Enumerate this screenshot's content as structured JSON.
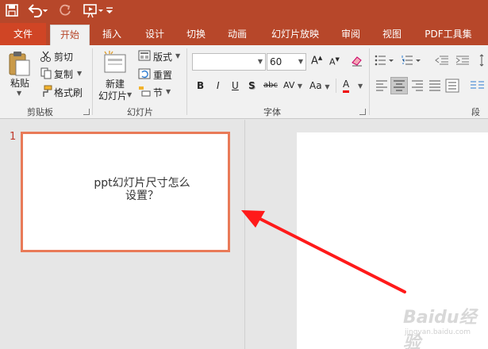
{
  "quick_access": {
    "icons": [
      "save-icon",
      "undo-icon",
      "redo-icon",
      "present-from-start-icon",
      "customize-qat-icon"
    ]
  },
  "tabs": [
    {
      "label": "文件"
    },
    {
      "label": "开始"
    },
    {
      "label": "插入"
    },
    {
      "label": "设计"
    },
    {
      "label": "切换"
    },
    {
      "label": "动画"
    },
    {
      "label": "幻灯片放映"
    },
    {
      "label": "审阅"
    },
    {
      "label": "视图"
    },
    {
      "label": "PDF工具集"
    }
  ],
  "ribbon": {
    "clipboard": {
      "paste": "粘贴",
      "cut": "剪切",
      "copy": "复制",
      "format_painter": "格式刷",
      "group_label": "剪贴板"
    },
    "slides": {
      "new_slide_line1": "新建",
      "new_slide_line2": "幻灯片",
      "layout": "版式",
      "reset": "重置",
      "section": "节",
      "group_label": "幻灯片"
    },
    "font": {
      "font_name": "",
      "font_size": "60",
      "bold": "B",
      "italic": "I",
      "underline": "U",
      "shadow": "S",
      "strike": "abc",
      "spacing": "AV",
      "case": "Aa",
      "color": "A",
      "grow": "A",
      "shrink": "A",
      "group_label": "字体"
    },
    "paragraph": {
      "group_label": "段落"
    }
  },
  "slides": [
    {
      "number": "1",
      "title_line1": "ppt幻灯片尺寸怎么",
      "title_line2": "设置？"
    }
  ],
  "watermark": {
    "brand": "Baidu经验",
    "url": "jingyan.baidu.com"
  },
  "colors": {
    "accent": "#b7472a",
    "file_tab": "#d04525",
    "selection_border": "#e97a58",
    "arrow": "#ff1a1a"
  }
}
